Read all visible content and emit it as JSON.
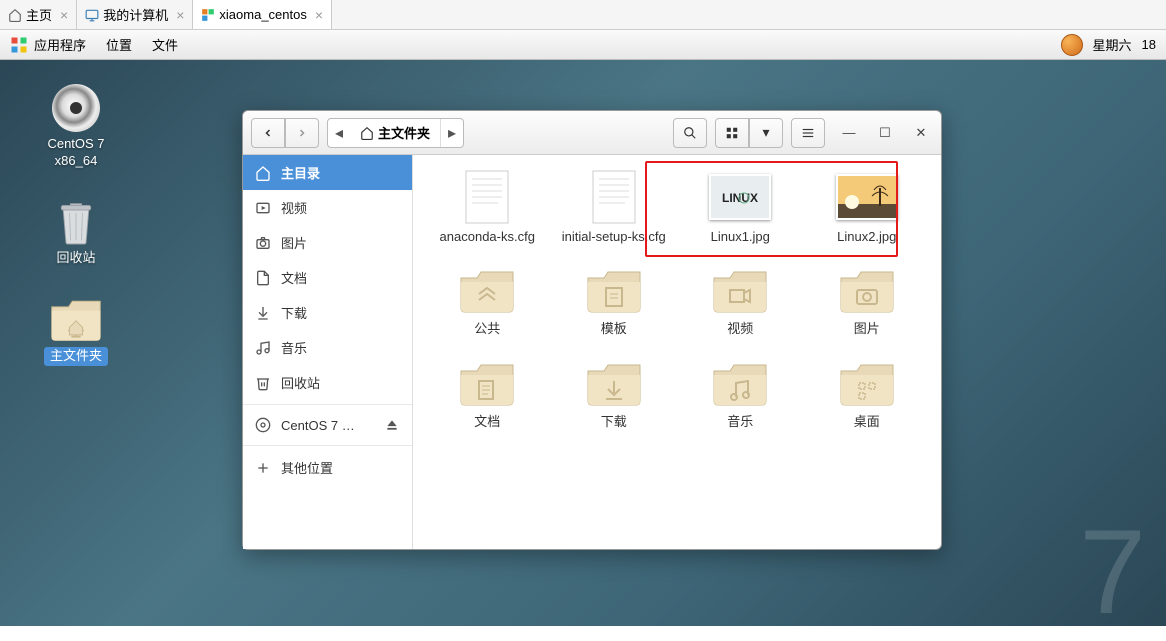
{
  "tabs": [
    {
      "label": "主页",
      "icon": "home"
    },
    {
      "label": "我的计算机",
      "icon": "monitor"
    },
    {
      "label": "xiaoma_centos",
      "icon": "vm",
      "active": true
    }
  ],
  "menubar": {
    "apps": "应用程序",
    "places": "位置",
    "files": "文件",
    "weekday": "星期六",
    "day": "18"
  },
  "desktop": {
    "disc_label_1": "CentOS 7",
    "disc_label_2": "x86_64",
    "trash_label": "回收站",
    "home_label": "主文件夹"
  },
  "fm": {
    "path_label": "主文件夹",
    "sidebar": {
      "home": "主目录",
      "videos": "视频",
      "pictures": "图片",
      "documents": "文档",
      "downloads": "下载",
      "music": "音乐",
      "trash": "回收站",
      "disc": "CentOS 7 …",
      "other": "其他位置"
    },
    "files": {
      "f1": "anaconda-ks.cfg",
      "f2": "initial-setup-ks.cfg",
      "f3": "Linux1.jpg",
      "f4": "Linux2.jpg",
      "d1": "公共",
      "d2": "模板",
      "d3": "视频",
      "d4": "图片",
      "d5": "文档",
      "d6": "下载",
      "d7": "音乐",
      "d8": "桌面"
    }
  }
}
